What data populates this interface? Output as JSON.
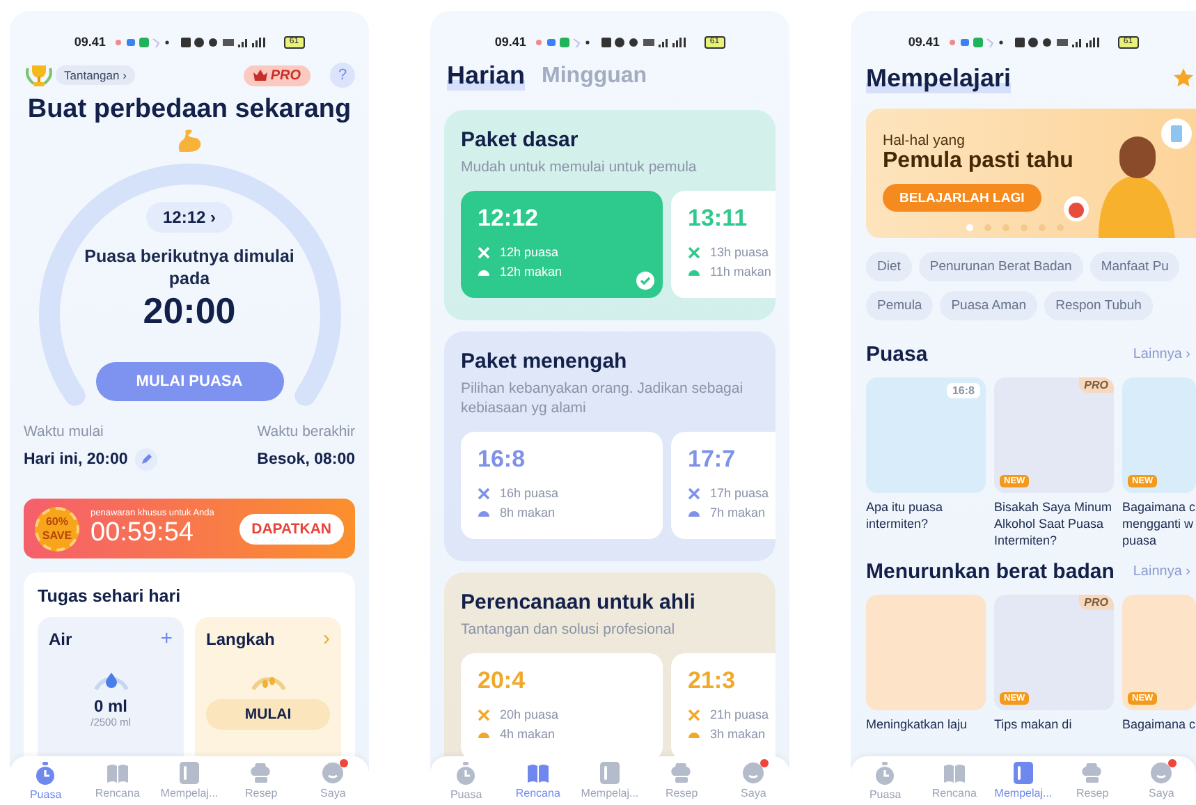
{
  "screens": [
    {
      "kind": "fasting",
      "status_bar": {
        "time": "09.41",
        "battery": "61"
      },
      "challenge": "Tantangan ›",
      "pro": "PRO",
      "help": "?",
      "headline": "Buat perbedaan sekarang",
      "plan_chip": "12:12 ›",
      "next_label": "Puasa berikutnya dimulai pada",
      "next_time": "20:00",
      "start_button": "MULAI PUASA",
      "start": {
        "label": "Waktu mulai",
        "value": "Hari ini, 20:00"
      },
      "end": {
        "label": "Waktu berakhir",
        "value": "Besok, 08:00"
      },
      "offer": {
        "percent": "60%",
        "save": "SAVE",
        "caption": "penawaran khusus untuk Anda",
        "countdown": "00:59:54",
        "button": "DAPATKAN"
      },
      "tasks": {
        "title": "Tugas sehari hari",
        "water": {
          "title": "Air",
          "action": "+",
          "amount": "0 ml",
          "goal": "/2500 ml"
        },
        "steps": {
          "title": "Langkah",
          "action": "›",
          "button": "MULAI"
        }
      },
      "nav": [
        {
          "label": "Puasa",
          "selected": true,
          "dot": false
        },
        {
          "label": "Rencana",
          "selected": false,
          "dot": false
        },
        {
          "label": "Mempelaj...",
          "selected": false,
          "dot": false
        },
        {
          "label": "Resep",
          "selected": false,
          "dot": false
        },
        {
          "label": "Saya",
          "selected": false,
          "dot": true
        }
      ]
    },
    {
      "kind": "plans",
      "status_bar": {
        "time": "09.41",
        "battery": "61"
      },
      "tabs": [
        {
          "label": "Harian",
          "selected": true
        },
        {
          "label": "Mingguan",
          "selected": false
        }
      ],
      "sections": [
        {
          "title": "Paket dasar",
          "subtitle": "Mudah untuk memulai untuk pemula",
          "color": "#2ec98c",
          "plans": [
            {
              "ratio": "12:12",
              "fasting": "12h puasa",
              "eating": "12h makan",
              "selected": true
            },
            {
              "ratio": "13:11",
              "fasting": "13h puasa",
              "eating": "11h makan",
              "selected": false
            }
          ]
        },
        {
          "title": "Paket menengah",
          "subtitle": "Pilihan kebanyakan orang. Jadikan sebagai kebiasaan yg alami",
          "color": "#7d92e8",
          "plans": [
            {
              "ratio": "16:8",
              "fasting": "16h puasa",
              "eating": "8h makan",
              "selected": false
            },
            {
              "ratio": "17:7",
              "fasting": "17h puasa",
              "eating": "7h makan",
              "selected": false
            }
          ]
        },
        {
          "title": "Perencanaan untuk ahli",
          "subtitle": "Tantangan dan solusi profesional",
          "color": "#f0a92a",
          "plans": [
            {
              "ratio": "20:4",
              "fasting": "20h puasa",
              "eating": "4h makan",
              "selected": false
            },
            {
              "ratio": "21:3",
              "fasting": "21h puasa",
              "eating": "3h makan",
              "selected": false
            }
          ]
        }
      ],
      "nav": [
        {
          "label": "Puasa",
          "selected": false,
          "dot": false
        },
        {
          "label": "Rencana",
          "selected": true,
          "dot": false
        },
        {
          "label": "Mempelaj...",
          "selected": false,
          "dot": false
        },
        {
          "label": "Resep",
          "selected": false,
          "dot": false
        },
        {
          "label": "Saya",
          "selected": false,
          "dot": true
        }
      ]
    },
    {
      "kind": "learn",
      "status_bar": {
        "time": "09.41",
        "battery": "61"
      },
      "title": "Mempelajari",
      "banner": {
        "kicker": "Hal-hal yang",
        "headline": "Pemula pasti tahu",
        "button": "BELAJARLAH LAGI",
        "pages": [
          {
            "selected": true
          },
          {
            "selected": false
          },
          {
            "selected": false
          },
          {
            "selected": false
          },
          {
            "selected": false
          },
          {
            "selected": false
          }
        ]
      },
      "tag_rows": [
        {
          "tags": [
            "Diet",
            "Penurunan Berat Badan",
            "Manfaat Pu"
          ]
        },
        {
          "tags": [
            "Pemula",
            "Puasa Aman",
            "Respon Tubuh"
          ]
        }
      ],
      "sections": [
        {
          "title": "Puasa",
          "more": "Lainnya ›",
          "articles": [
            {
              "title": "Apa itu puasa intermiten?",
              "label": "16:8"
            },
            {
              "title": "Bisakah Saya Minum Alkohol Saat Puasa Intermiten?",
              "label": "PRO",
              "new": "NEW"
            },
            {
              "title": "Bagaimana c mengganti w puasa",
              "new": "NEW"
            }
          ]
        },
        {
          "title": "Menurunkan berat badan",
          "more": "Lainnya ›",
          "articles": [
            {
              "title": "Meningkatkan laju"
            },
            {
              "title": "Tips makan di",
              "label": "PRO",
              "new": "NEW"
            },
            {
              "title": "Bagaimana c",
              "new": "NEW"
            }
          ]
        }
      ],
      "nav": [
        {
          "label": "Puasa",
          "selected": false,
          "dot": false
        },
        {
          "label": "Rencana",
          "selected": false,
          "dot": false
        },
        {
          "label": "Mempelaj...",
          "selected": true,
          "dot": false
        },
        {
          "label": "Resep",
          "selected": false,
          "dot": false
        },
        {
          "label": "Saya",
          "selected": false,
          "dot": true
        }
      ]
    }
  ]
}
